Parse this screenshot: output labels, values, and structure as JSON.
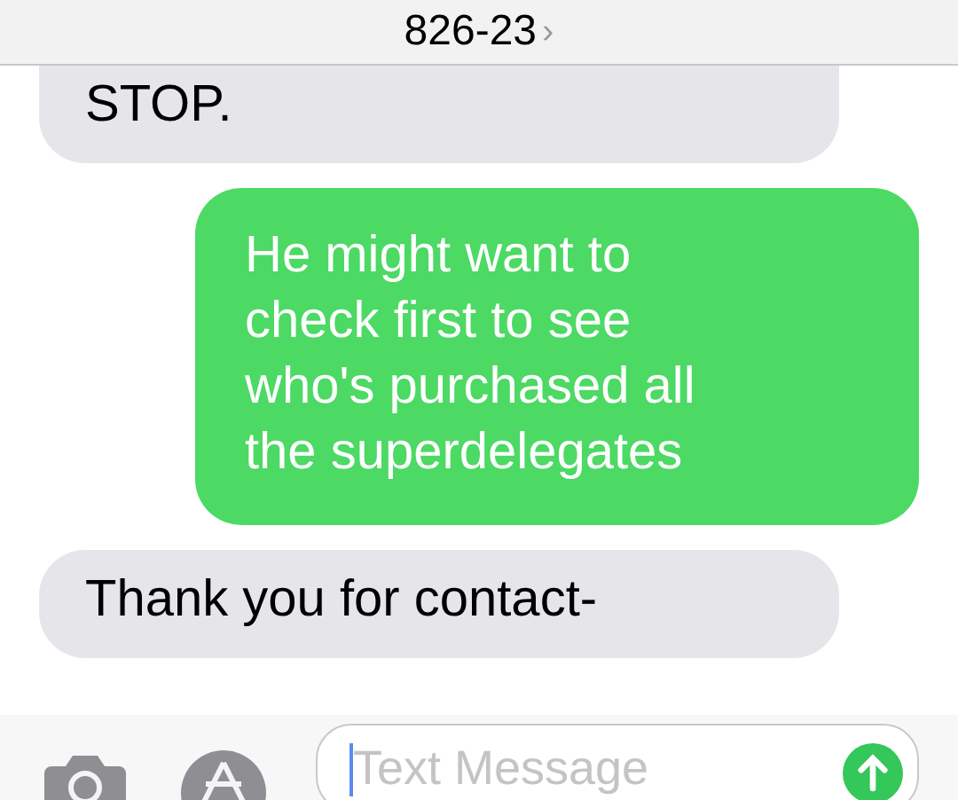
{
  "header": {
    "title": "826-23",
    "chevron": "›"
  },
  "messages": [
    {
      "kind": "received",
      "lines": [
        "STOP."
      ]
    },
    {
      "kind": "sent",
      "lines": [
        "He might want to",
        "check first to see",
        "who's purchased all",
        "the superdelegates"
      ]
    },
    {
      "kind": "received",
      "lines": [
        "Thank you for contact-"
      ]
    }
  ],
  "compose": {
    "placeholder": "Text Message"
  }
}
